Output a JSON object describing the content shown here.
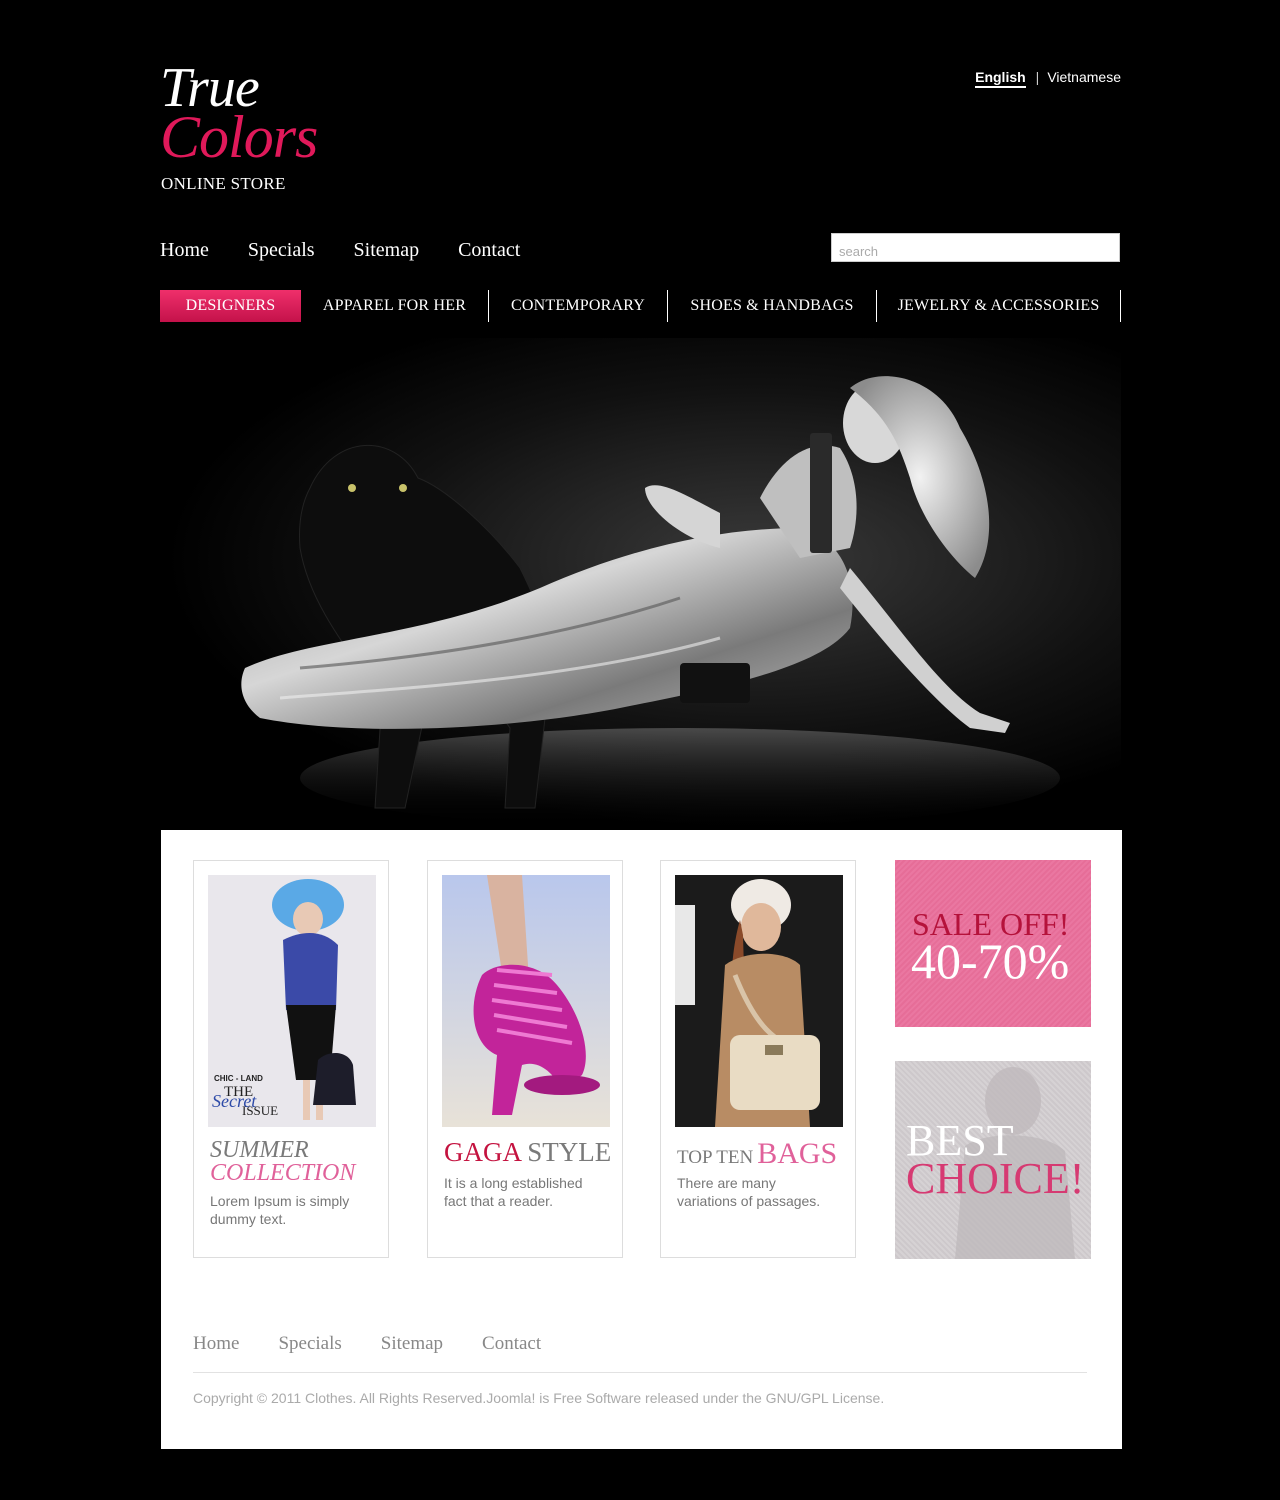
{
  "header": {
    "logo_line1": "True",
    "logo_line2": "Colors",
    "logo_sub": "ONLINE STORE"
  },
  "languages": {
    "active": "English",
    "separator": "|",
    "other": "Vietnamese"
  },
  "top_nav": [
    "Home",
    "Specials",
    "Sitemap",
    "Contact"
  ],
  "search": {
    "placeholder": "search"
  },
  "categories": [
    {
      "label": "DESIGNERS",
      "active": true
    },
    {
      "label": "APPAREL FOR HER",
      "active": false
    },
    {
      "label": "CONTEMPORARY",
      "active": false
    },
    {
      "label": "SHOES & HANDBAGS",
      "active": false
    },
    {
      "label": "JEWELRY & ACCESSORIES",
      "active": false
    }
  ],
  "cards": [
    {
      "title_part1": "SUMMER",
      "title_part2": "COLLECTION",
      "description": "Lorem Ipsum is simply dummy text.",
      "magazine_brand": "CHIC - LAND",
      "magazine_the": "THE",
      "magazine_secret": "Secret",
      "magazine_issue": "ISSUE"
    },
    {
      "title_part1": "GAGA",
      "title_part2": "STYLE",
      "description": "It is a long established fact that a reader."
    },
    {
      "title_part1": "TOP TEN",
      "title_part2": "BAGS",
      "description": "There are many variations of passages."
    }
  ],
  "promos": {
    "sale_line1": "SALE OFF!",
    "sale_line2": "40-70%",
    "best_line1": "BEST",
    "best_line2": "CHOICE!"
  },
  "footer": {
    "nav": [
      "Home",
      "Specials",
      "Sitemap",
      "Contact"
    ],
    "copyright": "Copyright © 2011 Clothes. All Rights Reserved.Joomla! is Free Software released under the GNU/GPL License."
  },
  "colors": {
    "brand_pink": "#e0195a",
    "accent_red": "#c4123f",
    "light_pink": "#e0619a",
    "background": "#000000"
  }
}
